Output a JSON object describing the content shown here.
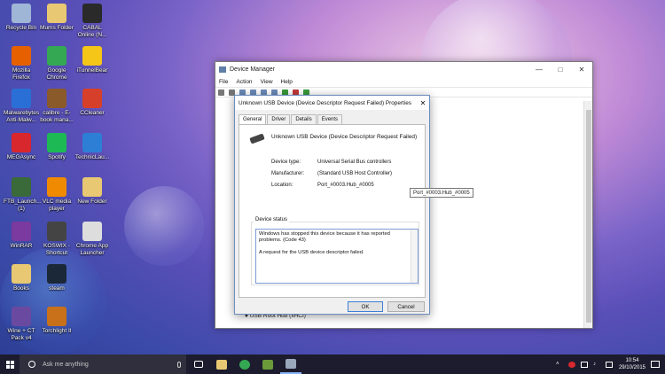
{
  "desktop_icons": [
    {
      "label": "Recycle Bin",
      "color": "#9fb6d6"
    },
    {
      "label": "Mums Folder",
      "color": "#e8c872"
    },
    {
      "label": "CABAL Online (N...",
      "color": "#2a2a2a"
    },
    {
      "label": "Mozilla Firefox",
      "color": "#e66000"
    },
    {
      "label": "Google Chrome",
      "color": "#34a853"
    },
    {
      "label": "iTunnelBear",
      "color": "#f5c518"
    },
    {
      "label": "Malwarebytes Anti-Malw...",
      "color": "#2a6fd6"
    },
    {
      "label": "calibre - E-book mana...",
      "color": "#8b5a2b"
    },
    {
      "label": "CCleaner",
      "color": "#d6402a"
    },
    {
      "label": "MEGAsync",
      "color": "#d9272e"
    },
    {
      "label": "Spotify",
      "color": "#1db954"
    },
    {
      "label": "TechnicLau...",
      "color": "#2d7fd6"
    },
    {
      "label": "FTB_Launch... (1)",
      "color": "#3a6a3a"
    },
    {
      "label": "VLC media player",
      "color": "#f08a00"
    },
    {
      "label": "New Folder",
      "color": "#e8c872"
    },
    {
      "label": "WinRAR",
      "color": "#7a3aa0"
    },
    {
      "label": "KOSWIX - Shortcut",
      "color": "#444444"
    },
    {
      "label": "Chrome App Launcher",
      "color": "#dddddd"
    },
    {
      "label": "Books",
      "color": "#e8c872"
    },
    {
      "label": "steam",
      "color": "#1b2838"
    },
    {
      "label": "Wine + CT Pack v4",
      "color": "#6a4aa0"
    },
    {
      "label": "Torchlight II",
      "color": "#c8701a"
    }
  ],
  "device_manager": {
    "title": "Device Manager",
    "menu": [
      "File",
      "Action",
      "View",
      "Help"
    ],
    "tree_last_item": "USB Root Hub (xHCI)"
  },
  "dialog": {
    "title": "Unknown USB Device (Device Descriptor Request Failed) Properties",
    "tabs": [
      "General",
      "Driver",
      "Details",
      "Events"
    ],
    "device_name": "Unknown USB Device (Device Descriptor Request Failed)",
    "device_type_label": "Device type:",
    "device_type_value": "Universal Serial Bus controllers",
    "manufacturer_label": "Manufacturer:",
    "manufacturer_value": "(Standard USB Host Controller)",
    "location_label": "Location:",
    "location_value": "Port_#0003.Hub_#0005",
    "status_group_label": "Device status",
    "status_line1": "Windows has stopped this device because it has reported problems. (Code 43)",
    "status_line2": "A request for the USB device descriptor failed.",
    "ok_label": "OK",
    "cancel_label": "Cancel"
  },
  "tooltip": "Port_#0003.Hub_#0005",
  "taskbar": {
    "search_placeholder": "Ask me anything",
    "time": "10:54",
    "date": "29/10/2015"
  }
}
